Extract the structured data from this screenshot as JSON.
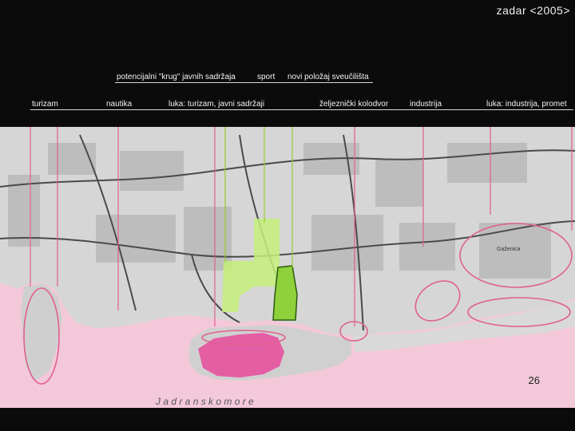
{
  "slide": {
    "title": "zadar <2005>",
    "page_number": "26"
  },
  "annotations_top": [
    {
      "key": "krug",
      "text": "potencijalni \"krug\" javnih sadržaja"
    },
    {
      "key": "sport",
      "text": "sport"
    },
    {
      "key": "sveuciliste",
      "text": "novi položaj sveučilišta"
    }
  ],
  "annotations_bottom": [
    {
      "key": "turizam",
      "text": "turizam"
    },
    {
      "key": "nautika",
      "text": "nautika"
    },
    {
      "key": "luka_turizam",
      "text": "luka: turizam, javni sadržaji"
    },
    {
      "key": "zeljeznicki",
      "text": "željeznički kolodvor"
    },
    {
      "key": "industrija",
      "text": "industrija"
    },
    {
      "key": "luka_industrija",
      "text": "luka: industrija, promet"
    }
  ],
  "map": {
    "sea_label": "J a d r a n s k o     m o r e",
    "district_label": "Gaženica",
    "colors": {
      "sea": "#f3c9da",
      "land": "#d9d9d9",
      "old_town": "#e84a9c",
      "green_zone": "#8fd13a",
      "green_zone_light": "#c4f07a",
      "marker": "#e0608f",
      "green_marker": "#9ccc33"
    }
  }
}
